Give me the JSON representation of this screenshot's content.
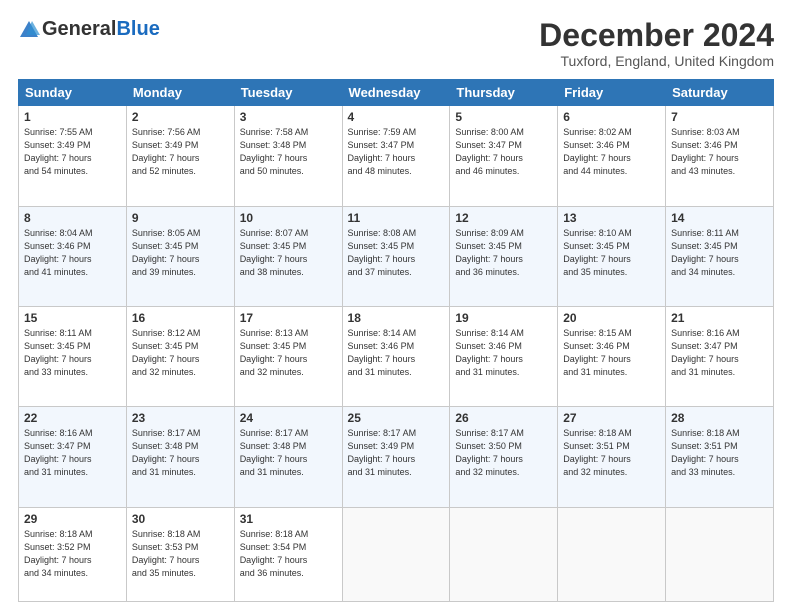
{
  "logo": {
    "general": "General",
    "blue": "Blue"
  },
  "title": "December 2024",
  "subtitle": "Tuxford, England, United Kingdom",
  "days_of_week": [
    "Sunday",
    "Monday",
    "Tuesday",
    "Wednesday",
    "Thursday",
    "Friday",
    "Saturday"
  ],
  "weeks": [
    [
      {
        "day": "1",
        "sunrise": "7:55 AM",
        "sunset": "3:49 PM",
        "daylight": "7 hours and 54 minutes."
      },
      {
        "day": "2",
        "sunrise": "7:56 AM",
        "sunset": "3:49 PM",
        "daylight": "7 hours and 52 minutes."
      },
      {
        "day": "3",
        "sunrise": "7:58 AM",
        "sunset": "3:48 PM",
        "daylight": "7 hours and 50 minutes."
      },
      {
        "day": "4",
        "sunrise": "7:59 AM",
        "sunset": "3:47 PM",
        "daylight": "7 hours and 48 minutes."
      },
      {
        "day": "5",
        "sunrise": "8:00 AM",
        "sunset": "3:47 PM",
        "daylight": "7 hours and 46 minutes."
      },
      {
        "day": "6",
        "sunrise": "8:02 AM",
        "sunset": "3:46 PM",
        "daylight": "7 hours and 44 minutes."
      },
      {
        "day": "7",
        "sunrise": "8:03 AM",
        "sunset": "3:46 PM",
        "daylight": "7 hours and 43 minutes."
      }
    ],
    [
      {
        "day": "8",
        "sunrise": "8:04 AM",
        "sunset": "3:46 PM",
        "daylight": "7 hours and 41 minutes."
      },
      {
        "day": "9",
        "sunrise": "8:05 AM",
        "sunset": "3:45 PM",
        "daylight": "7 hours and 39 minutes."
      },
      {
        "day": "10",
        "sunrise": "8:07 AM",
        "sunset": "3:45 PM",
        "daylight": "7 hours and 38 minutes."
      },
      {
        "day": "11",
        "sunrise": "8:08 AM",
        "sunset": "3:45 PM",
        "daylight": "7 hours and 37 minutes."
      },
      {
        "day": "12",
        "sunrise": "8:09 AM",
        "sunset": "3:45 PM",
        "daylight": "7 hours and 36 minutes."
      },
      {
        "day": "13",
        "sunrise": "8:10 AM",
        "sunset": "3:45 PM",
        "daylight": "7 hours and 35 minutes."
      },
      {
        "day": "14",
        "sunrise": "8:11 AM",
        "sunset": "3:45 PM",
        "daylight": "7 hours and 34 minutes."
      }
    ],
    [
      {
        "day": "15",
        "sunrise": "8:11 AM",
        "sunset": "3:45 PM",
        "daylight": "7 hours and 33 minutes."
      },
      {
        "day": "16",
        "sunrise": "8:12 AM",
        "sunset": "3:45 PM",
        "daylight": "7 hours and 32 minutes."
      },
      {
        "day": "17",
        "sunrise": "8:13 AM",
        "sunset": "3:45 PM",
        "daylight": "7 hours and 32 minutes."
      },
      {
        "day": "18",
        "sunrise": "8:14 AM",
        "sunset": "3:46 PM",
        "daylight": "7 hours and 31 minutes."
      },
      {
        "day": "19",
        "sunrise": "8:14 AM",
        "sunset": "3:46 PM",
        "daylight": "7 hours and 31 minutes."
      },
      {
        "day": "20",
        "sunrise": "8:15 AM",
        "sunset": "3:46 PM",
        "daylight": "7 hours and 31 minutes."
      },
      {
        "day": "21",
        "sunrise": "8:16 AM",
        "sunset": "3:47 PM",
        "daylight": "7 hours and 31 minutes."
      }
    ],
    [
      {
        "day": "22",
        "sunrise": "8:16 AM",
        "sunset": "3:47 PM",
        "daylight": "7 hours and 31 minutes."
      },
      {
        "day": "23",
        "sunrise": "8:17 AM",
        "sunset": "3:48 PM",
        "daylight": "7 hours and 31 minutes."
      },
      {
        "day": "24",
        "sunrise": "8:17 AM",
        "sunset": "3:48 PM",
        "daylight": "7 hours and 31 minutes."
      },
      {
        "day": "25",
        "sunrise": "8:17 AM",
        "sunset": "3:49 PM",
        "daylight": "7 hours and 31 minutes."
      },
      {
        "day": "26",
        "sunrise": "8:17 AM",
        "sunset": "3:50 PM",
        "daylight": "7 hours and 32 minutes."
      },
      {
        "day": "27",
        "sunrise": "8:18 AM",
        "sunset": "3:51 PM",
        "daylight": "7 hours and 32 minutes."
      },
      {
        "day": "28",
        "sunrise": "8:18 AM",
        "sunset": "3:51 PM",
        "daylight": "7 hours and 33 minutes."
      }
    ],
    [
      {
        "day": "29",
        "sunrise": "8:18 AM",
        "sunset": "3:52 PM",
        "daylight": "7 hours and 34 minutes."
      },
      {
        "day": "30",
        "sunrise": "8:18 AM",
        "sunset": "3:53 PM",
        "daylight": "7 hours and 35 minutes."
      },
      {
        "day": "31",
        "sunrise": "8:18 AM",
        "sunset": "3:54 PM",
        "daylight": "7 hours and 36 minutes."
      },
      null,
      null,
      null,
      null
    ]
  ]
}
